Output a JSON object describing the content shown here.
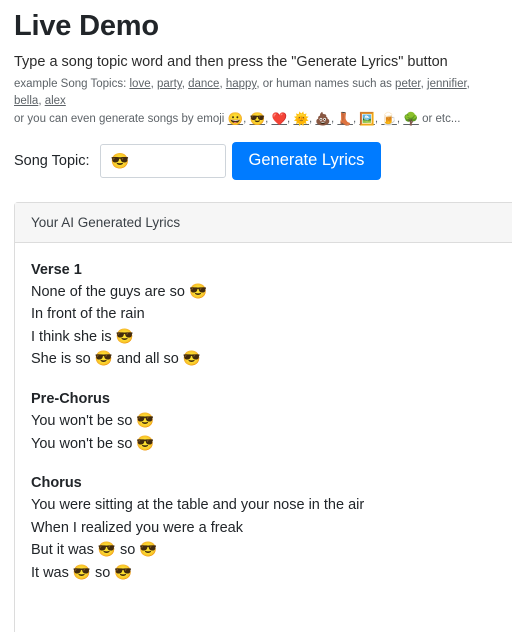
{
  "header": {
    "title": "Live Demo",
    "lead": "Type a song topic word and then press the \"Generate Lyrics\" button",
    "examples": {
      "prefix": "example Song Topics: ",
      "word_links": [
        "love",
        "party",
        "dance",
        "happy"
      ],
      "mid": ", or human names such as ",
      "name_links": [
        "peter",
        "jennifier",
        "bella",
        "alex"
      ],
      "emoji_prefix": "or you can even generate songs by emoji ",
      "emoji_links": [
        {
          "name": "smiling-face-emoji",
          "glyph": "😀"
        },
        {
          "name": "sunglasses-face-emoji",
          "glyph": "😎"
        },
        {
          "name": "red-heart-emoji",
          "glyph": "❤️"
        },
        {
          "name": "sun-emoji",
          "glyph": "🌞"
        },
        {
          "name": "pile-of-poo-emoji",
          "glyph": "💩"
        },
        {
          "name": "womans-boot-emoji",
          "glyph": "👢"
        },
        {
          "name": "framed-picture-emoji",
          "glyph": "🖼️"
        },
        {
          "name": "beer-mug-emoji",
          "glyph": "🍺"
        },
        {
          "name": "tree-emoji",
          "glyph": "🌳"
        }
      ],
      "emoji_suffix": " or etc..."
    }
  },
  "form": {
    "label": "Song Topic:",
    "input_value": "😎",
    "input_placeholder": "",
    "button_label": "Generate Lyrics"
  },
  "card": {
    "header_title": "Your AI Generated Lyrics",
    "sections": [
      {
        "title": "Verse 1",
        "lines": [
          "None of the guys are so 😎",
          "In front of the rain",
          "I think she is 😎",
          "She is so 😎 and all so 😎"
        ]
      },
      {
        "title": "Pre-Chorus",
        "lines": [
          "You won't be so 😎",
          "You won't be so 😎"
        ]
      },
      {
        "title": "Chorus",
        "lines": [
          "You were sitting at the table and your nose in the air",
          "When I realized you were a freak",
          "But it was 😎 so 😎",
          "It was 😎 so 😎"
        ]
      }
    ]
  },
  "colors": {
    "primary_button": "#007bff",
    "card_header_bg": "#f6f6f6",
    "card_border": "#dcdcdc",
    "muted_text": "#5d6368",
    "body_text": "#212529"
  }
}
